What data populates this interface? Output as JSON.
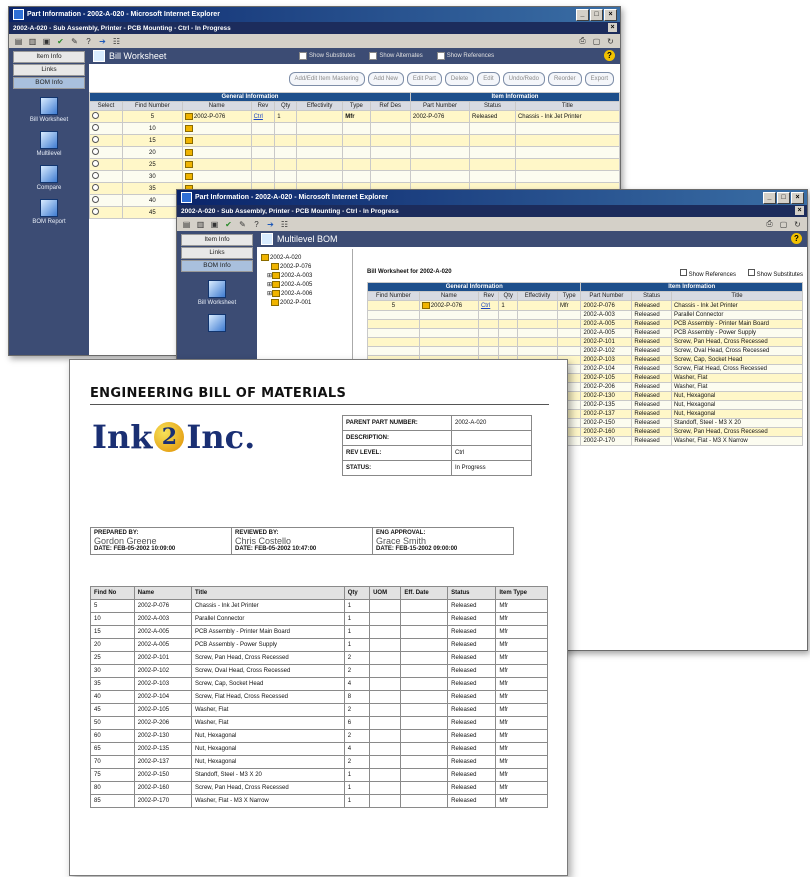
{
  "win1": {
    "title": "Part Information - 2002-A-020 - Microsoft Internet Explorer",
    "subtitle": "2002-A-020 - Sub Assembly, Printer - PCB Mounting - Ctrl - In Progress",
    "nav": [
      "Item Info",
      "Links",
      "BOM Info"
    ],
    "side_icons": [
      "Bill Worksheet",
      "Multilevel",
      "Compare",
      "BOM Report"
    ],
    "header": "Bill Worksheet",
    "checks": [
      "Show Substitutes",
      "Show Alternates",
      "Show References"
    ],
    "buttons": [
      "Add/Edit Item Mastering",
      "Add New",
      "Edit Part",
      "Delete",
      "Edit",
      "Undo/Redo",
      "Reorder",
      "Export"
    ],
    "group_general": "General Information",
    "group_item": "Item Information",
    "columns": [
      "Select",
      "Find Number",
      "Name",
      "Rev",
      "Qty",
      "Effectivity",
      "Type",
      "Ref Des",
      "Part Number",
      "Status",
      "Title"
    ],
    "rows": [
      {
        "find": "5",
        "name": "2002-P-076",
        "rev": "Ctrl",
        "qty": "1",
        "type": "Mfr",
        "part": "2002-P-076",
        "status": "Released",
        "title": "Chassis - Ink Jet Printer"
      },
      {
        "find": "10",
        "name": "",
        "rev": "",
        "qty": "",
        "type": "",
        "part": "",
        "status": "",
        "title": ""
      },
      {
        "find": "15",
        "name": "",
        "rev": "",
        "qty": "",
        "type": "",
        "part": "",
        "status": "",
        "title": ""
      },
      {
        "find": "20",
        "name": "",
        "rev": "",
        "qty": "",
        "type": "",
        "part": "",
        "status": "",
        "title": ""
      },
      {
        "find": "25",
        "name": "",
        "rev": "",
        "qty": "",
        "type": "",
        "part": "",
        "status": "",
        "title": ""
      },
      {
        "find": "30",
        "name": "",
        "rev": "",
        "qty": "",
        "type": "",
        "part": "",
        "status": "",
        "title": ""
      },
      {
        "find": "35",
        "name": "",
        "rev": "",
        "qty": "",
        "type": "",
        "part": "",
        "status": "",
        "title": ""
      },
      {
        "find": "40",
        "name": "",
        "rev": "",
        "qty": "",
        "type": "",
        "part": "",
        "status": "",
        "title": ""
      },
      {
        "find": "45",
        "name": "",
        "rev": "",
        "qty": "",
        "type": "",
        "part": "",
        "status": "",
        "title": ""
      }
    ]
  },
  "win2": {
    "title": "Part Information - 2002-A-020 - Microsoft Internet Explorer",
    "subtitle": "2002-A-020 - Sub Assembly, Printer - PCB Mounting - Ctrl - In Progress",
    "nav": [
      "Item Info",
      "Links",
      "BOM Info"
    ],
    "side_icons": [
      "Bill Worksheet"
    ],
    "header": "Multilevel BOM",
    "tree": [
      "2002-A-020",
      "2002-P-076",
      "2002-A-003",
      "2002-A-005",
      "2002-A-006",
      "2002-P-001"
    ],
    "worksheet_label": "Bill Worksheet for 2002-A-020",
    "checks": [
      "Show References",
      "Show Substitutes"
    ],
    "group_general": "General Information",
    "group_item": "Item Information",
    "columns": [
      "Find Number",
      "Name",
      "Rev",
      "Qty",
      "Effectivity",
      "Type",
      "Part Number",
      "Status",
      "Title"
    ],
    "rows": [
      {
        "find": "5",
        "name": "2002-P-076",
        "rev": "Ctrl",
        "qty": "1",
        "type": "Mfr",
        "part": "2002-P-076",
        "status": "Released",
        "title": "Chassis - Ink Jet Printer"
      },
      {
        "find": "",
        "name": "",
        "rev": "",
        "qty": "",
        "type": "",
        "part": "2002-A-003",
        "status": "Released",
        "title": "Parallel Connector"
      },
      {
        "find": "",
        "name": "",
        "rev": "",
        "qty": "",
        "type": "",
        "part": "2002-A-005",
        "status": "Released",
        "title": "PCB Assembly - Printer Main Board"
      },
      {
        "find": "",
        "name": "",
        "rev": "",
        "qty": "",
        "type": "",
        "part": "2002-A-005",
        "status": "Released",
        "title": "PCB Assembly - Power Supply"
      },
      {
        "find": "",
        "name": "",
        "rev": "",
        "qty": "",
        "type": "",
        "part": "2002-P-101",
        "status": "Released",
        "title": "Screw, Pan Head, Cross Recessed"
      },
      {
        "find": "",
        "name": "",
        "rev": "",
        "qty": "",
        "type": "",
        "part": "2002-P-102",
        "status": "Released",
        "title": "Screw, Oval Head, Cross Recessed"
      },
      {
        "find": "",
        "name": "",
        "rev": "",
        "qty": "",
        "type": "",
        "part": "2002-P-103",
        "status": "Released",
        "title": "Screw, Cap, Socket Head"
      },
      {
        "find": "",
        "name": "",
        "rev": "",
        "qty": "",
        "type": "",
        "part": "2002-P-104",
        "status": "Released",
        "title": "Screw, Flat Head, Cross Recessed"
      },
      {
        "find": "",
        "name": "",
        "rev": "",
        "qty": "",
        "type": "",
        "part": "2002-P-105",
        "status": "Released",
        "title": "Washer, Flat"
      },
      {
        "find": "",
        "name": "",
        "rev": "",
        "qty": "",
        "type": "",
        "part": "2002-P-206",
        "status": "Released",
        "title": "Washer, Flat"
      },
      {
        "find": "",
        "name": "",
        "rev": "",
        "qty": "",
        "type": "",
        "part": "2002-P-130",
        "status": "Released",
        "title": "Nut, Hexagonal"
      },
      {
        "find": "",
        "name": "",
        "rev": "",
        "qty": "",
        "type": "",
        "part": "2002-P-135",
        "status": "Released",
        "title": "Nut, Hexagonal"
      },
      {
        "find": "",
        "name": "",
        "rev": "",
        "qty": "",
        "type": "",
        "part": "2002-P-137",
        "status": "Released",
        "title": "Nut, Hexagonal"
      },
      {
        "find": "",
        "name": "",
        "rev": "",
        "qty": "",
        "type": "",
        "part": "2002-P-150",
        "status": "Released",
        "title": "Standoff, Steel - M3 X 20"
      },
      {
        "find": "",
        "name": "",
        "rev": "",
        "qty": "",
        "type": "",
        "part": "2002-P-160",
        "status": "Released",
        "title": "Screw, Pan Head, Cross Recessed"
      },
      {
        "find": "",
        "name": "",
        "rev": "",
        "qty": "",
        "type": "",
        "part": "2002-P-170",
        "status": "Released",
        "title": "Washer, Flat - M3 X Narrow"
      }
    ]
  },
  "report": {
    "title": "ENGINEERING BILL OF MATERIALS",
    "logo_left": "Ink",
    "logo_mid": "2",
    "logo_right": "Inc.",
    "parent_fields": [
      {
        "label": "PARENT PART NUMBER:",
        "value": "2002-A-020"
      },
      {
        "label": "DESCRIPTION:",
        "value": ""
      },
      {
        "label": "REV LEVEL:",
        "value": "Ctrl"
      },
      {
        "label": "STATUS:",
        "value": "In Progress"
      }
    ],
    "prepared_label": "PREPARED BY:",
    "prepared_name": "Gordon Greene",
    "prepared_date": "DATE: FEB-05-2002 10:09:00",
    "reviewed_label": "REVIEWED BY:",
    "reviewed_name": "Chris Costello",
    "reviewed_date": "DATE: FEB-05-2002 10:47:00",
    "approval_label": "ENG APPROVAL:",
    "approval_name": "Grace Smith",
    "approval_date": "DATE: FEB-15-2002 09:00:00",
    "columns": [
      "Find No",
      "Name",
      "Title",
      "Qty",
      "UOM",
      "Eff. Date",
      "Status",
      "Item Type"
    ],
    "rows": [
      {
        "find": "5",
        "name": "2002-P-076",
        "title": "Chassis - Ink Jet Printer",
        "qty": "1",
        "status": "Released",
        "type": "Mfr"
      },
      {
        "find": "10",
        "name": "2002-A-003",
        "title": "Parallel Connector",
        "qty": "1",
        "status": "Released",
        "type": "Mfr"
      },
      {
        "find": "15",
        "name": "2002-A-005",
        "title": "PCB Assembly - Printer Main Board",
        "qty": "1",
        "status": "Released",
        "type": "Mfr"
      },
      {
        "find": "20",
        "name": "2002-A-005",
        "title": "PCB Assembly - Power Supply",
        "qty": "1",
        "status": "Released",
        "type": "Mfr"
      },
      {
        "find": "25",
        "name": "2002-P-101",
        "title": "Screw, Pan Head, Cross Recessed",
        "qty": "2",
        "status": "Released",
        "type": "Mfr"
      },
      {
        "find": "30",
        "name": "2002-P-102",
        "title": "Screw, Oval Head, Cross Recessed",
        "qty": "2",
        "status": "Released",
        "type": "Mfr"
      },
      {
        "find": "35",
        "name": "2002-P-103",
        "title": "Screw, Cap, Socket Head",
        "qty": "4",
        "status": "Released",
        "type": "Mfr"
      },
      {
        "find": "40",
        "name": "2002-P-104",
        "title": "Screw, Flat Head, Cross Recessed",
        "qty": "8",
        "status": "Released",
        "type": "Mfr"
      },
      {
        "find": "45",
        "name": "2002-P-105",
        "title": "Washer, Flat",
        "qty": "2",
        "status": "Released",
        "type": "Mfr"
      },
      {
        "find": "50",
        "name": "2002-P-206",
        "title": "Washer, Flat",
        "qty": "6",
        "status": "Released",
        "type": "Mfr"
      },
      {
        "find": "60",
        "name": "2002-P-130",
        "title": "Nut, Hexagonal",
        "qty": "2",
        "status": "Released",
        "type": "Mfr"
      },
      {
        "find": "65",
        "name": "2002-P-135",
        "title": "Nut, Hexagonal",
        "qty": "4",
        "status": "Released",
        "type": "Mfr"
      },
      {
        "find": "70",
        "name": "2002-P-137",
        "title": "Nut, Hexagonal",
        "qty": "2",
        "status": "Released",
        "type": "Mfr"
      },
      {
        "find": "75",
        "name": "2002-P-150",
        "title": "Standoff, Steel - M3 X 20",
        "qty": "1",
        "status": "Released",
        "type": "Mfr"
      },
      {
        "find": "80",
        "name": "2002-P-160",
        "title": "Screw, Pan Head, Cross Recessed",
        "qty": "1",
        "status": "Released",
        "type": "Mfr"
      },
      {
        "find": "85",
        "name": "2002-P-170",
        "title": "Washer, Flat - M3 X Narrow",
        "qty": "1",
        "status": "Released",
        "type": "Mfr"
      }
    ]
  },
  "colors": {
    "title_bar": "#0a246a",
    "panel": "#3c4c74",
    "grid_header": "#1d4f8c",
    "row_highlight": "#fff7c8"
  },
  "icons": [
    "folder-icon",
    "help-icon",
    "print-icon",
    "refresh-icon",
    "close-icon",
    "minimize-icon",
    "maximize-icon",
    "checkmark-icon"
  ]
}
